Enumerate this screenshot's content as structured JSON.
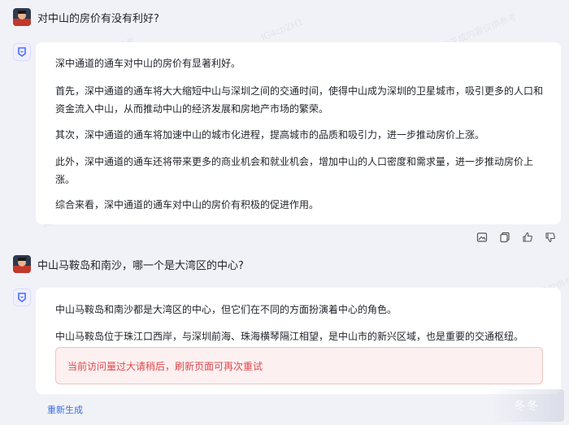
{
  "conversation": {
    "question1": "对中山的房价有没有利好?",
    "answer1": {
      "paragraphs": [
        "深中通道的通车对中山的房价有显著利好。",
        "首先，深中通道的通车将大大缩短中山与深圳之间的交通时间，使得中山成为深圳的卫星城市，吸引更多的人口和资金流入中山，从而推动中山的经济发展和房地产市场的繁荣。",
        "其次，深中通道的通车将加速中山的城市化进程，提高城市的品质和吸引力，进一步推动房价上涨。",
        "此外，深中通道的通车还将带来更多的商业机会和就业机会，增加中山的人口密度和需求量，进一步推动房价上涨。",
        "综合来看，深中通道的通车对中山的房价有积极的促进作用。"
      ]
    },
    "question2": "中山马鞍岛和南沙，哪一个是大湾区的中心?",
    "answer2": {
      "paragraphs": [
        "中山马鞍岛和南沙都是大湾区的中心，但它们在不同的方面扮演着中心的角色。",
        "中山马鞍岛位于珠江口西岸，与深圳前海、珠海横琴隔江相望，是中山市的新兴区域，也是重要的交通枢纽。"
      ],
      "error": "当前访问量过大请稍后，刷新页面可再次重试"
    },
    "regenerate_label": "重新生成"
  },
  "actions": [
    "image-icon",
    "copy-icon",
    "thumbs-up-icon",
    "thumbs-down-icon"
  ],
  "watermark_text": "AI生成内容仅供参考",
  "watermark_code": "IG4cbZH1",
  "corner_logo_text": "冬冬"
}
